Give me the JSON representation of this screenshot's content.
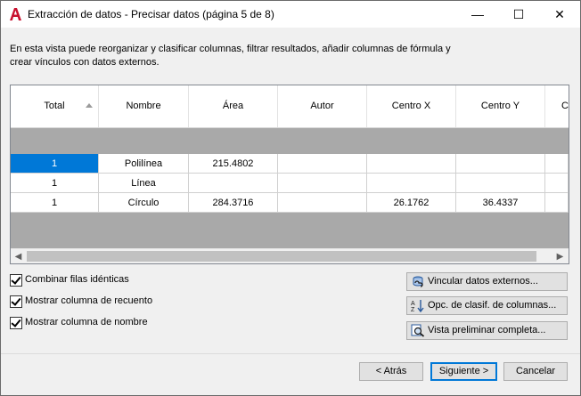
{
  "window": {
    "title": "Extracción de datos - Precisar datos (página 5 de 8)",
    "app_icon": "autocad-icon",
    "controls": {
      "minimize": "—",
      "maximize": "☐",
      "close": "✕"
    }
  },
  "description": "En esta vista puede reorganizar y clasificar columnas, filtrar resultados, añadir columnas de fórmula y crear vínculos con datos externos.",
  "grid": {
    "columns": [
      "Total",
      "Nombre",
      "Área",
      "Autor",
      "Centro X",
      "Centro Y",
      "C"
    ],
    "sorted_column": "Total",
    "rows": [
      [
        "1",
        "Polilínea",
        "215.4802",
        "",
        "",
        "",
        ""
      ],
      [
        "1",
        "Línea",
        "",
        "",
        "",
        "",
        ""
      ],
      [
        "1",
        "Círculo",
        "284.3716",
        "",
        "26.1762",
        "36.4337",
        ""
      ]
    ],
    "selected_cell": "1"
  },
  "options": {
    "combine": {
      "label": "Combinar filas idénticas",
      "checked": true
    },
    "count": {
      "label": "Mostrar columna de recuento",
      "checked": true
    },
    "name": {
      "label": "Mostrar columna de nombre",
      "checked": true
    }
  },
  "side_buttons": {
    "link": {
      "label": "Vincular datos externos...",
      "icon": "link-data-icon"
    },
    "sort": {
      "label": "Opc. de clasif. de columnas...",
      "icon": "sort-az-icon"
    },
    "preview": {
      "label": "Vista preliminar completa...",
      "icon": "preview-magnifier-icon"
    }
  },
  "nav_buttons": {
    "back": "< Atrás",
    "next": "Siguiente >",
    "cancel": "Cancelar"
  },
  "colors": {
    "selection": "#0078d7",
    "grid_empty": "#a9a9a9",
    "app_red": "#c8102e"
  }
}
